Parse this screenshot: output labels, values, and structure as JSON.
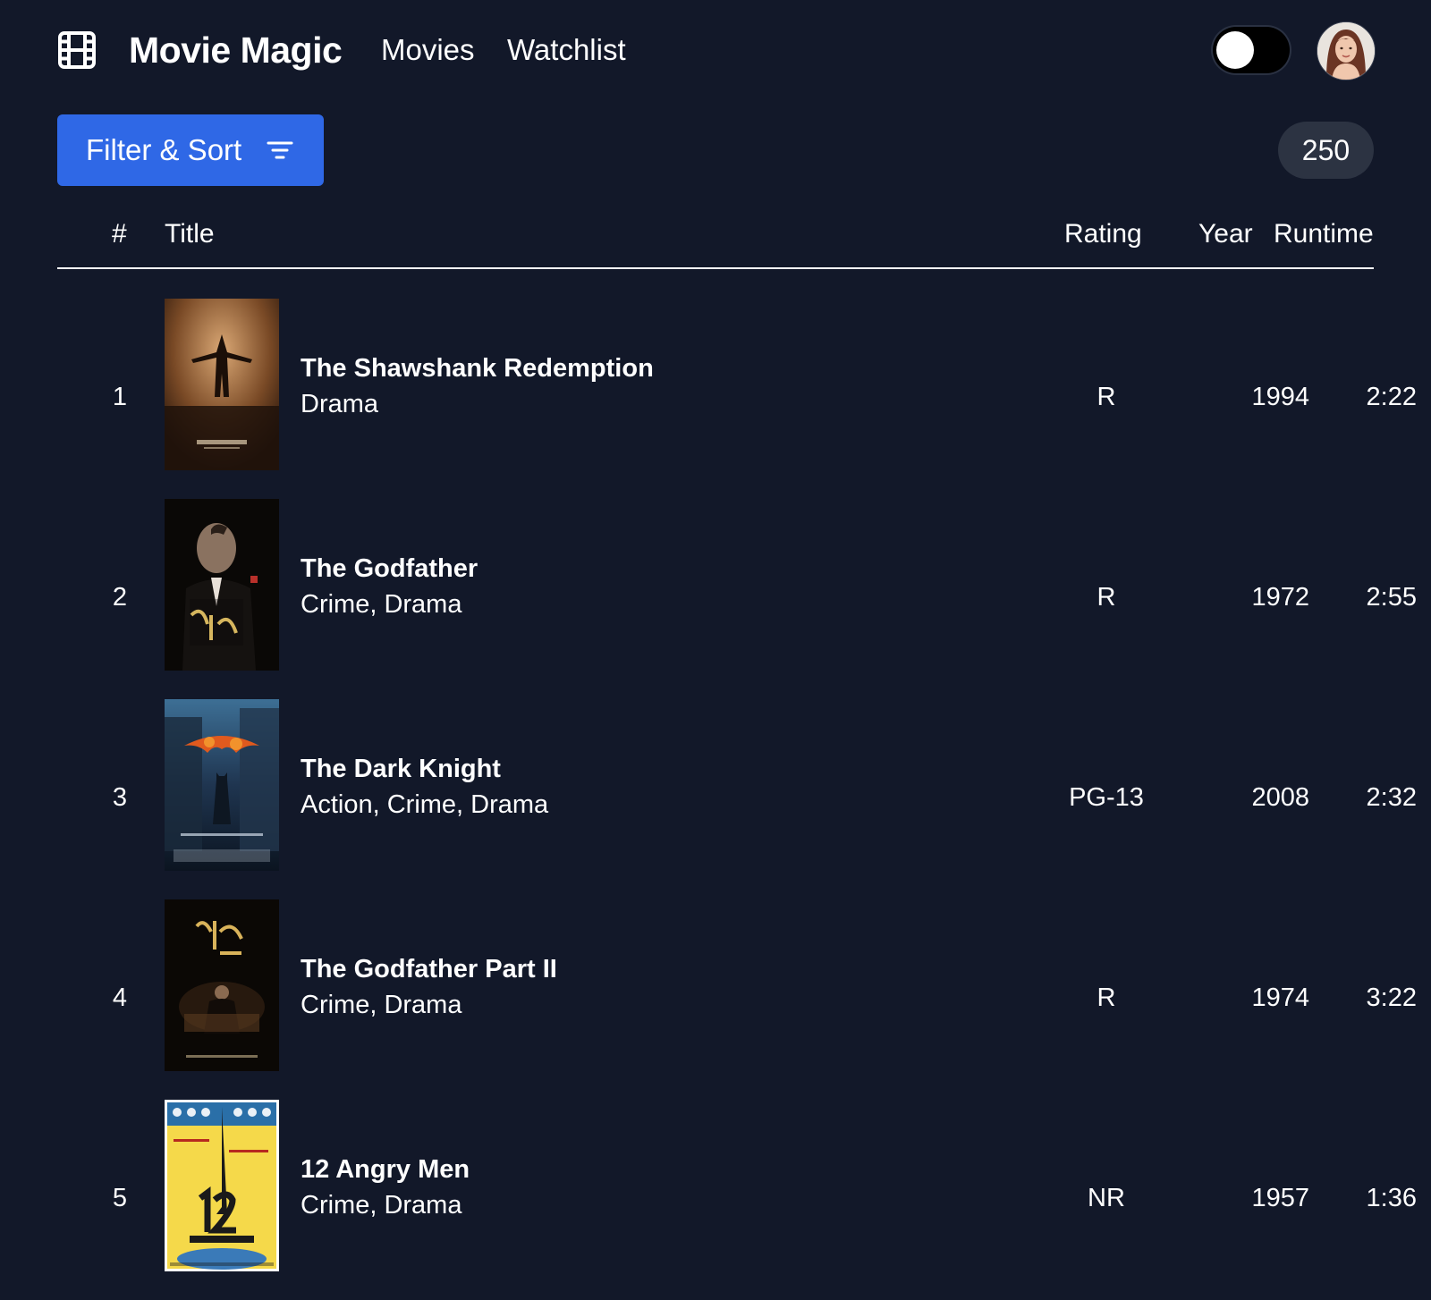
{
  "nav": {
    "brand": "Movie Magic",
    "links": [
      "Movies",
      "Watchlist"
    ],
    "logo_icon": "film-icon",
    "theme_toggle": "dark-mode-toggle",
    "avatar_icon": "user-avatar"
  },
  "toolbar": {
    "filter_label": "Filter & Sort",
    "filter_icon": "filter-lines-icon",
    "count": "250"
  },
  "table": {
    "columns": [
      "#",
      "Title",
      "Rating",
      "Year",
      "Runtime"
    ],
    "rows": [
      {
        "rank": "1",
        "title": "The Shawshank Redemption",
        "genre": "Drama",
        "rating": "R",
        "year": "1994",
        "runtime": "2:22"
      },
      {
        "rank": "2",
        "title": "The Godfather",
        "genre": "Crime, Drama",
        "rating": "R",
        "year": "1972",
        "runtime": "2:55"
      },
      {
        "rank": "3",
        "title": "The Dark Knight",
        "genre": "Action, Crime, Drama",
        "rating": "PG-13",
        "year": "2008",
        "runtime": "2:32"
      },
      {
        "rank": "4",
        "title": "The Godfather Part II",
        "genre": "Crime, Drama",
        "rating": "R",
        "year": "1974",
        "runtime": "3:22"
      },
      {
        "rank": "5",
        "title": "12 Angry Men",
        "genre": "Crime, Drama",
        "rating": "NR",
        "year": "1957",
        "runtime": "1:36"
      }
    ]
  },
  "colors": {
    "background": "#121829",
    "accent": "#2f68e6",
    "badge": "#2c3342",
    "text": "#ffffff"
  }
}
